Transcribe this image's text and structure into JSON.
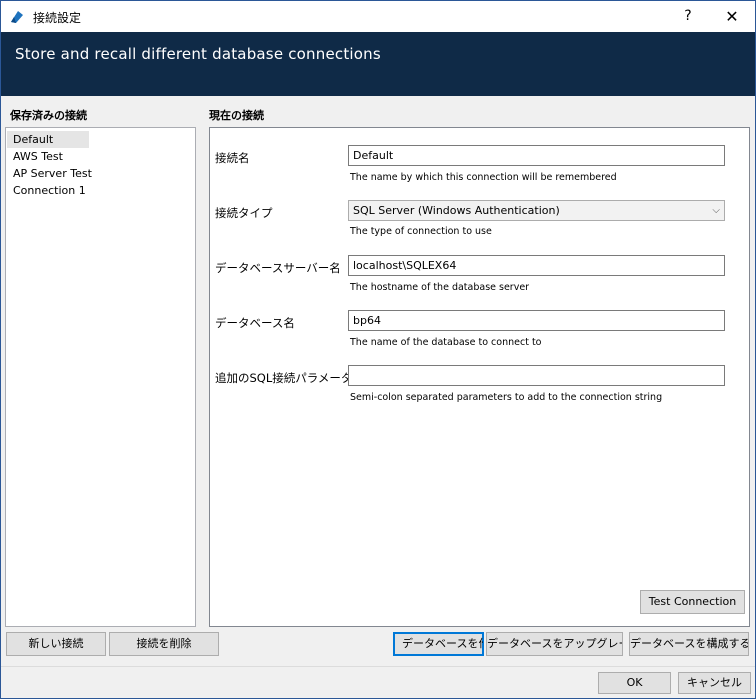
{
  "window": {
    "title": "接続設定",
    "help_label": "?",
    "close_label": "✕"
  },
  "banner": {
    "text": "Store and recall different database connections"
  },
  "saved": {
    "title": "保存済みの接続",
    "items": [
      "Default",
      "AWS Test",
      "AP Server Test",
      "Connection 1"
    ],
    "new_button": "新しい接続",
    "delete_button": "接続を削除"
  },
  "current": {
    "title": "現在の接続",
    "fields": {
      "name": {
        "label": "接続名",
        "value": "Default",
        "help": "The name by which this connection will be remembered"
      },
      "type": {
        "label": "接続タイプ",
        "value": "SQL Server (Windows Authentication)",
        "help": "The type of connection to use"
      },
      "server": {
        "label": "データベースサーバー名",
        "value": "localhost\\SQLEX64",
        "help": "The hostname of the database server"
      },
      "database": {
        "label": "データベース名",
        "value": "bp64",
        "help": "The name of the database to connect to"
      },
      "params": {
        "label": "追加のSQL接続パラメータ",
        "value": "",
        "help": "Semi-colon separated parameters to add to the connection string"
      }
    },
    "test_button": "Test Connection"
  },
  "actions": {
    "create_db": "データベースを作成",
    "upgrade_db": "データベースをアップグレード",
    "configure_db": "データベースを構成する"
  },
  "footer": {
    "ok": "OK",
    "cancel": "キャンセル"
  },
  "colors": {
    "banner": "#0f2a47",
    "accent": "#0078d7"
  }
}
